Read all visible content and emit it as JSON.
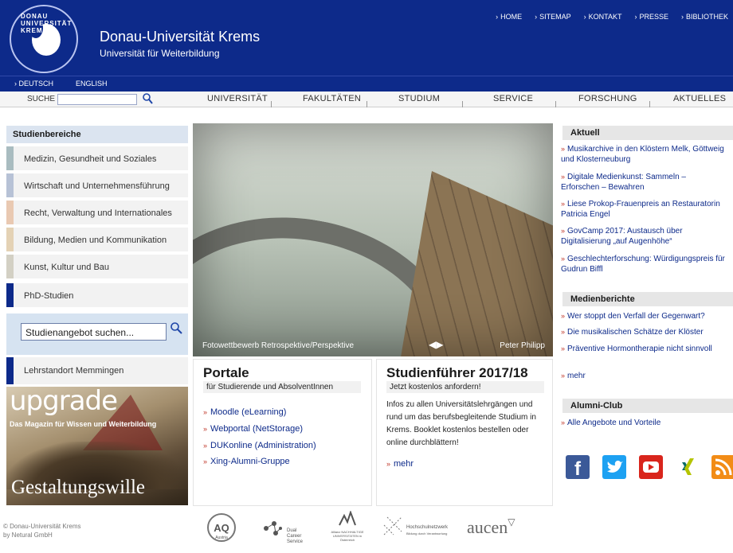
{
  "header": {
    "title": "Donau-Universität Krems",
    "subtitle": "Universität für Weiterbildung",
    "logo_text": "DONAU UNIVERSITÄT KREMS",
    "top_links": [
      "HOME",
      "SITEMAP",
      "KONTAKT",
      "PRESSE",
      "BIBLIOTHEK"
    ]
  },
  "lang": {
    "deutsch": "DEUTSCH",
    "english": "ENGLISH"
  },
  "nav": {
    "search_label": "SUCHE",
    "items": [
      "UNIVERSITÄT",
      "FAKULTÄTEN",
      "STUDIUM",
      "SERVICE",
      "FORSCHUNG",
      "AKTUELLES"
    ]
  },
  "sidebar": {
    "heading": "Studienbereiche",
    "items": [
      {
        "label": "Medizin, Gesundheit und Soziales",
        "color": "#a9bcc0"
      },
      {
        "label": "Wirtschaft und Unternehmensführung",
        "color": "#b7c2d6"
      },
      {
        "label": "Recht, Verwaltung und Internationales",
        "color": "#e9c9b2"
      },
      {
        "label": "Bildung, Medien und Kommunikation",
        "color": "#e4d2b5"
      },
      {
        "label": "Kunst, Kultur und Bau",
        "color": "#d3d0c4"
      },
      {
        "label": "PhD-Studien",
        "color": "#0d2a8a"
      }
    ],
    "search_placeholder": "Studienangebot suchen...",
    "memmingen": "Lehrstandort Memmingen"
  },
  "upgrade": {
    "word": "upgrade",
    "tagline": "Das Magazin für Wissen und Weiterbildung",
    "theme": "Gestaltungswille"
  },
  "footer": {
    "copyright_line1": "© Donau-Universität Krems",
    "copyright_line2": "by Netural GmbH"
  },
  "hero": {
    "caption": "Fotowettbewerb Retrospektive/Perspektive",
    "credit": "Peter Philipp"
  },
  "portale": {
    "title": "Portale",
    "subtitle": "für Studierende und AbsolventInnen",
    "links": [
      "Moodle (eLearning)",
      "Webportal (NetStorage)",
      "DUKonline (Administration)",
      "Xing-Alumni-Gruppe"
    ]
  },
  "studienfuehrer": {
    "title": "Studienführer 2017/18",
    "subtitle": "Jetzt kostenlos anfordern!",
    "body": "Infos zu allen Universitätslehrgängen und rund um das berufsbegleitende Studium in Krems. Booklet kostenlos bestellen oder online durchblättern!",
    "more": "mehr"
  },
  "aktuell": {
    "heading": "Aktuell",
    "items": [
      "Musikarchive in den Klöstern Melk, Göttweig und Klosterneuburg",
      "Digitale Medienkunst: Sammeln – Erforschen – Bewahren",
      "Liese Prokop-Frauenpreis an Restauratorin Patricia Engel",
      "GovCamp 2017: Austausch über Digitalisierung „auf Augenhöhe“",
      "Geschlechterforschung: Würdigungspreis für Gudrun Biffl"
    ]
  },
  "medien": {
    "heading": "Medienberichte",
    "items": [
      "Wer stoppt den Verfall der Gegenwart?",
      "Die musikalischen Schätze der Klöster",
      "Präventive Hormontherapie nicht sinnvoll",
      "mehr"
    ]
  },
  "alumni": {
    "heading": "Alumni-Club",
    "items": [
      "Alle Angebote und Vorteile"
    ]
  },
  "social": {
    "icons": [
      "facebook-icon",
      "twitter-icon",
      "youtube-icon",
      "xing-icon",
      "rss-icon"
    ],
    "colors": [
      "#3b5998",
      "#1da1f2",
      "#d9251c",
      "#ffffff",
      "#f28c16"
    ]
  },
  "partners": {
    "aq_top": "AQ",
    "aq_bottom": "Austria",
    "dual": "Dual Career Service",
    "allianz": "Allianz NACHHALTIGE UNIVERSITÄTEN in Österreich",
    "hochschul": "Hochschulnetzwerk",
    "hochschul_sub": "Bildung durch Verantwortung",
    "aucen": "aucen"
  }
}
